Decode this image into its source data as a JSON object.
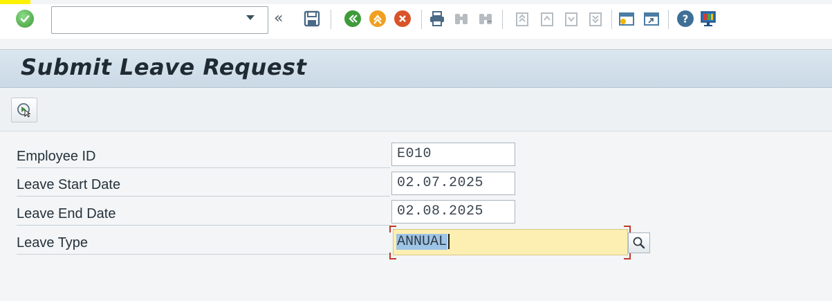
{
  "toolbar": {
    "command_field_value": "",
    "icons": [
      "enter-icon",
      "save-icon",
      "back-icon",
      "exit-icon",
      "cancel-icon",
      "print-icon",
      "find-icon",
      "find-next-icon",
      "first-page-icon",
      "previous-page-icon",
      "next-page-icon",
      "last-page-icon",
      "new-session-icon",
      "shortcut-icon",
      "help-icon",
      "customize-layout-icon"
    ]
  },
  "title": "Submit Leave Request",
  "form": {
    "employee_id": {
      "label": "Employee ID",
      "value": "E010"
    },
    "leave_start_date": {
      "label": "Leave Start Date",
      "value": "02.07.2025"
    },
    "leave_end_date": {
      "label": "Leave End Date",
      "value": "02.08.2025"
    },
    "leave_type": {
      "label": "Leave Type",
      "value": "ANNUAL"
    }
  },
  "colors": {
    "title_bar": "#cfdde8",
    "focused_field": "#fcefb1",
    "selection": "#9ec4e6",
    "focus_corners": "#c0392b"
  }
}
